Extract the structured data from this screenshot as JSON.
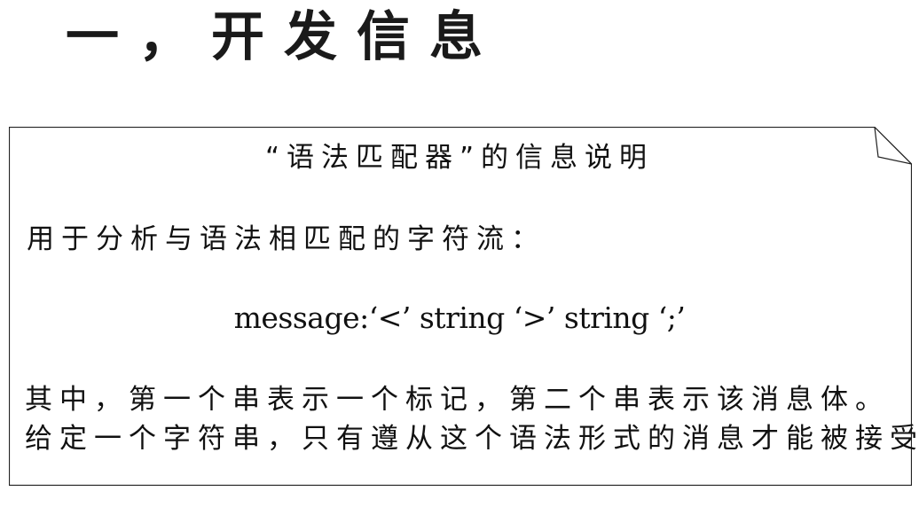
{
  "heading": "一，开发信息",
  "note": {
    "title": "“语法匹配器”的信息说明",
    "intro": "用于分析与语法相匹配的字符流：",
    "grammar": "message:‘<’ string ‘>’ string ‘;’",
    "lines": [
      "其中，第一个串表示一个标记，第二个串表示该消息体。",
      "给定一个字符串，只有遵从这个语法形式的消息才能被接受。"
    ]
  }
}
